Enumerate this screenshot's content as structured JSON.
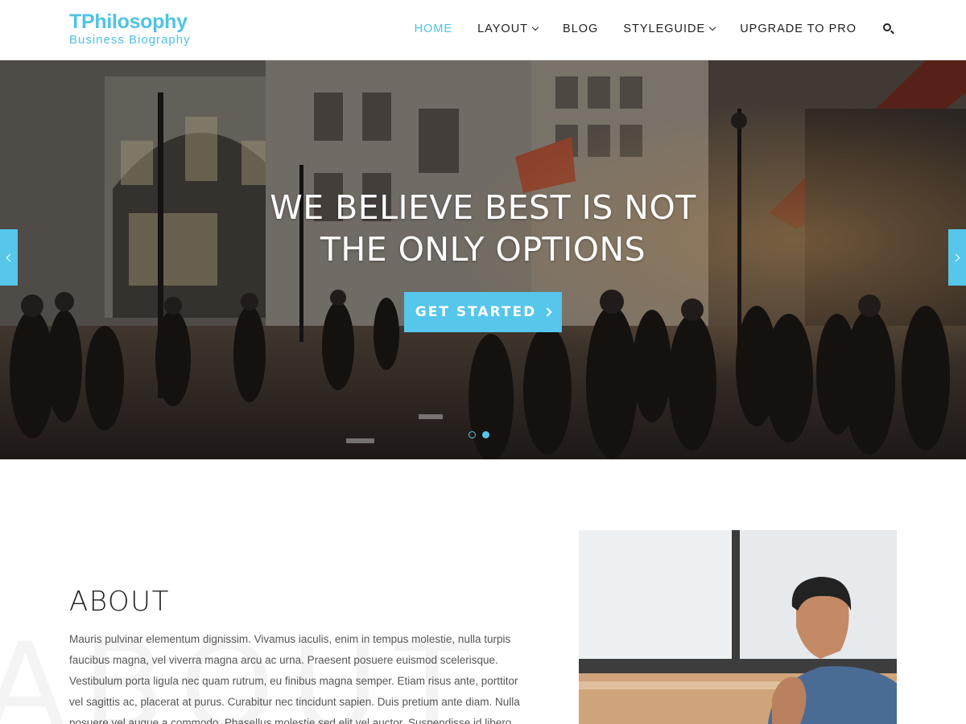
{
  "header": {
    "site_title": "TPhilosophy",
    "tagline": "Business Biography",
    "nav": [
      {
        "label": "HOME",
        "active": true,
        "dropdown": false
      },
      {
        "label": "LAYOUT",
        "active": false,
        "dropdown": true
      },
      {
        "label": "BLOG",
        "active": false,
        "dropdown": false
      },
      {
        "label": "STYLEGUIDE",
        "active": false,
        "dropdown": true
      },
      {
        "label": "UPGRADE TO PRO",
        "active": false,
        "dropdown": false
      }
    ],
    "search_icon": "search-icon"
  },
  "hero": {
    "title_line1": "WE BELIEVE BEST IS NOT",
    "title_line2": "THE ONLY OPTIONS",
    "cta_label": "GET STARTED",
    "slides": 2,
    "active_slide": 2
  },
  "about": {
    "heading": "ABOUT",
    "watermark": "ABOUT",
    "body": "Mauris pulvinar elementum dignissim. Vivamus iaculis, enim in tempus molestie, nulla turpis faucibus magna, vel viverra magna arcu ac urna. Praesent posuere euismod scelerisque. Vestibulum porta ligula nec quam rutrum, eu finibus magna semper. Etiam risus ante, porttitor vel sagittis ac, placerat at purus. Curabitur nec tincidunt sapien. Duis pretium ante diam. Nulla posuere vel augue a commodo. Phasellus molestie sed elit vel auctor. Suspendisse id libero"
  },
  "colors": {
    "accent": "#56c6ea",
    "text_dark": "#222222",
    "text_body": "#555555"
  }
}
